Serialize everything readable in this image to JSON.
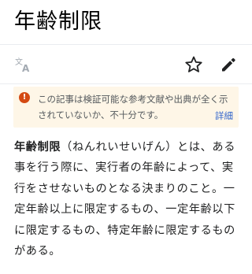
{
  "page": {
    "title": "年齢制限"
  },
  "toolbar": {
    "language_icon": "translate-icon",
    "watch_icon": "star-icon",
    "edit_icon": "pencil-icon"
  },
  "notice": {
    "icon": "!",
    "icon_color": "#d44a13",
    "background_color": "#fef6e7",
    "text": "この記事は検証可能な参考文献や出典が全く示されていないか、不十分です。",
    "more_link": "詳細",
    "link_color": "#3366cc"
  },
  "article": {
    "term": "年齢制限",
    "reading": "（ねんれいせいげん）",
    "body": "とは、ある事を行う際に、実行者の年齢によって、実行をさせないものとなる決まりのこと。一定年齢以上に限定するもの、一定年齢以下に限定するもの、特定年齢に限定するものがある。"
  }
}
